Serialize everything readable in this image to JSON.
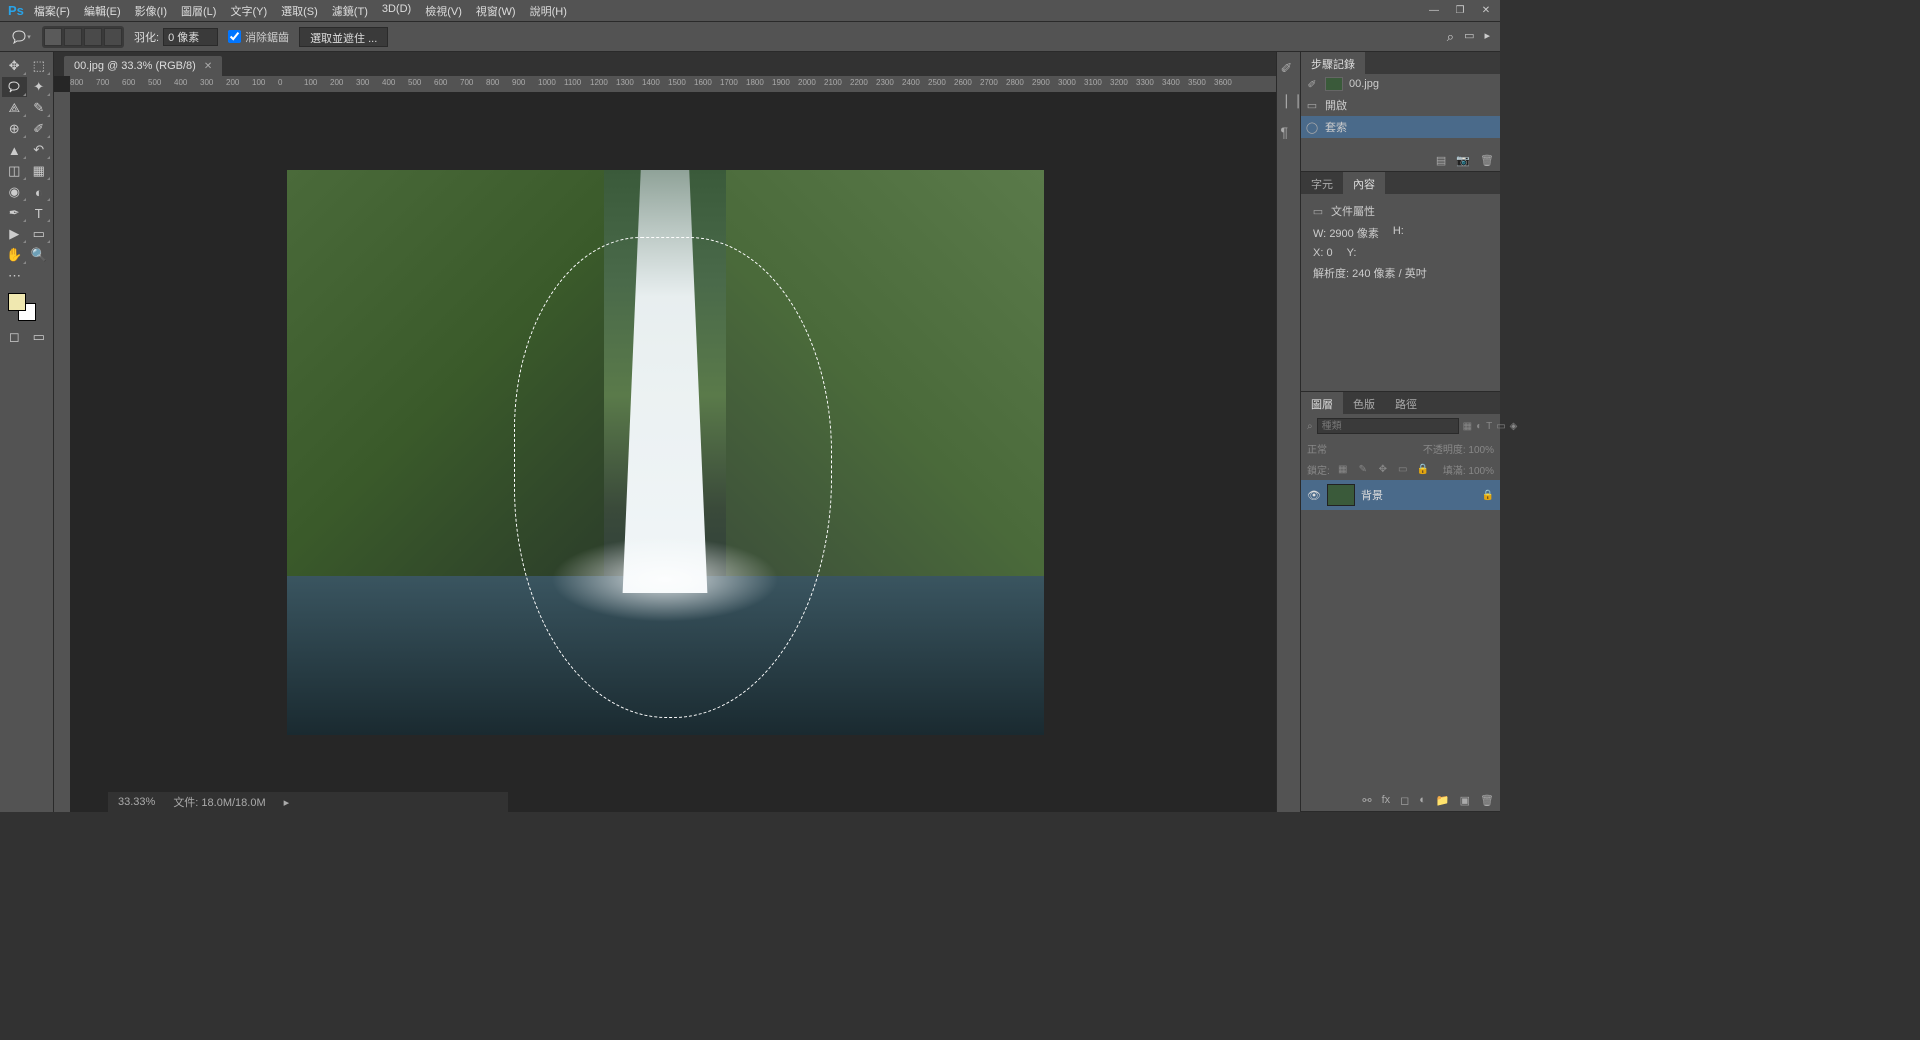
{
  "app": {
    "logo": "Ps"
  },
  "menu": [
    "檔案(F)",
    "編輯(E)",
    "影像(I)",
    "圖層(L)",
    "文字(Y)",
    "選取(S)",
    "濾鏡(T)",
    "3D(D)",
    "檢視(V)",
    "視窗(W)",
    "說明(H)"
  ],
  "options": {
    "feather_label": "羽化:",
    "feather_value": "0 像素",
    "antialias": "消除鋸齒",
    "select_mask": "選取並遮住 ..."
  },
  "tab": {
    "title": "00.jpg @ 33.3% (RGB/8)"
  },
  "rulers_h": [
    "800",
    "700",
    "600",
    "500",
    "400",
    "300",
    "200",
    "100",
    "0",
    "100",
    "200",
    "300",
    "400",
    "500",
    "600",
    "700",
    "800",
    "900",
    "1000",
    "1100",
    "1200",
    "1300",
    "1400",
    "1500",
    "1600",
    "1700",
    "1800",
    "1900",
    "2000",
    "2100",
    "2200",
    "2300",
    "2400",
    "2500",
    "2600",
    "2700",
    "2800",
    "2900",
    "3000",
    "3100",
    "3200",
    "3300",
    "3400",
    "3500",
    "3600"
  ],
  "history": {
    "title": "步驟記錄",
    "doc": "00.jpg",
    "items": [
      "開啟",
      "套索"
    ]
  },
  "props": {
    "tab_char": "字元",
    "tab_props": "內容",
    "doc_props": "文件屬性",
    "w_label": "W:",
    "w_val": "2900 像素",
    "h_label": "H:",
    "x_label": "X:",
    "x_val": "0",
    "y_label": "Y:",
    "res": "解析度: 240 像素 / 英吋"
  },
  "layers": {
    "tab_layers": "圖層",
    "tab_channels": "色版",
    "tab_paths": "路徑",
    "filter_ph": "種類",
    "blend": "正常",
    "opacity_label": "不透明度:",
    "opacity_val": "100%",
    "lock_label": "鎖定:",
    "fill_label": "填滿:",
    "fill_val": "100%",
    "layer_name": "背景"
  },
  "status": {
    "zoom": "33.33%",
    "doc_info": "文件: 18.0M/18.0M"
  }
}
